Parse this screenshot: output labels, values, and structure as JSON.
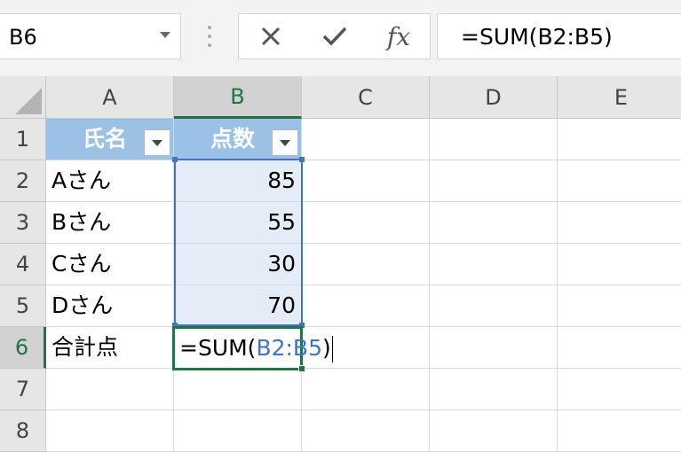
{
  "name_box": {
    "value": "B6"
  },
  "formula_bar": {
    "cancel_icon": "close-icon",
    "enter_icon": "check-icon",
    "fx_label": "fx",
    "formula": "=SUM(B2:B5)"
  },
  "columns": [
    "A",
    "B",
    "C",
    "D",
    "E"
  ],
  "rows": [
    "1",
    "2",
    "3",
    "4",
    "5",
    "6",
    "7",
    "8"
  ],
  "table": {
    "headers": [
      "氏名",
      "点数"
    ],
    "rows": [
      {
        "name": "Aさん",
        "score": "85"
      },
      {
        "name": "Bさん",
        "score": "55"
      },
      {
        "name": "Cさん",
        "score": "30"
      },
      {
        "name": "Dさん",
        "score": "70"
      }
    ]
  },
  "total_row": {
    "label": "合計点",
    "editing_prefix": "=SUM(",
    "editing_ref": "B2:B5",
    "editing_suffix": ")"
  },
  "colors": {
    "header_fill": "#9bc2e6",
    "selection_green": "#217346",
    "range_blue": "#4472c4"
  }
}
